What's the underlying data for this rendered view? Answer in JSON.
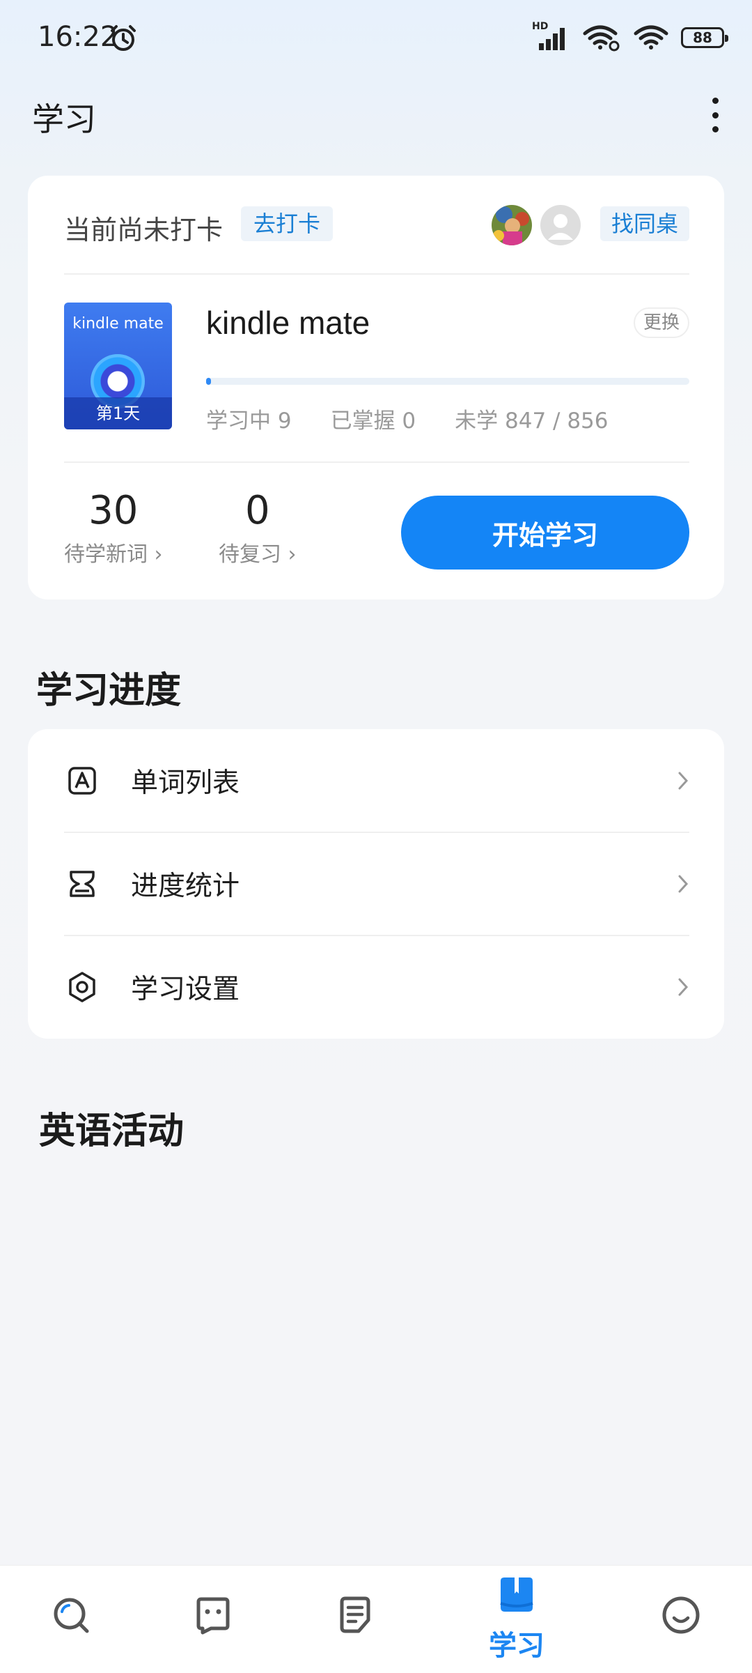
{
  "status_bar": {
    "time": "16:22",
    "network": "HD",
    "battery": "88"
  },
  "header": {
    "title": "学习"
  },
  "study_card": {
    "checkin_text": "当前尚未打卡",
    "checkin_button": "去打卡",
    "find_deskmate_button": "找同桌",
    "book": {
      "cover_title": "kindle mate",
      "cover_day": "第1天",
      "name": "kindle mate",
      "change_button": "更换",
      "progress_fraction": 0.01,
      "stat_learning": "学习中 9",
      "stat_mastered": "已掌握 0",
      "stat_unlearned": "未学 847 / 856"
    },
    "new_words_count": "30",
    "new_words_label": "待学新词 ›",
    "review_count": "0",
    "review_label": "待复习 ›",
    "start_button": "开始学习"
  },
  "progress_section": {
    "title": "学习进度",
    "items": [
      {
        "label": "单词列表",
        "icon": "word-list-icon"
      },
      {
        "label": "进度统计",
        "icon": "hourglass-icon"
      },
      {
        "label": "学习设置",
        "icon": "settings-icon"
      }
    ]
  },
  "activity_section": {
    "title": "英语活动"
  },
  "bottom_nav": {
    "items": [
      {
        "icon": "search-icon"
      },
      {
        "icon": "chat-icon"
      },
      {
        "icon": "notes-icon"
      },
      {
        "icon": "study-book-icon",
        "label": "学习",
        "active": true
      },
      {
        "icon": "smile-icon"
      }
    ],
    "active_color": "#1c86f2"
  }
}
